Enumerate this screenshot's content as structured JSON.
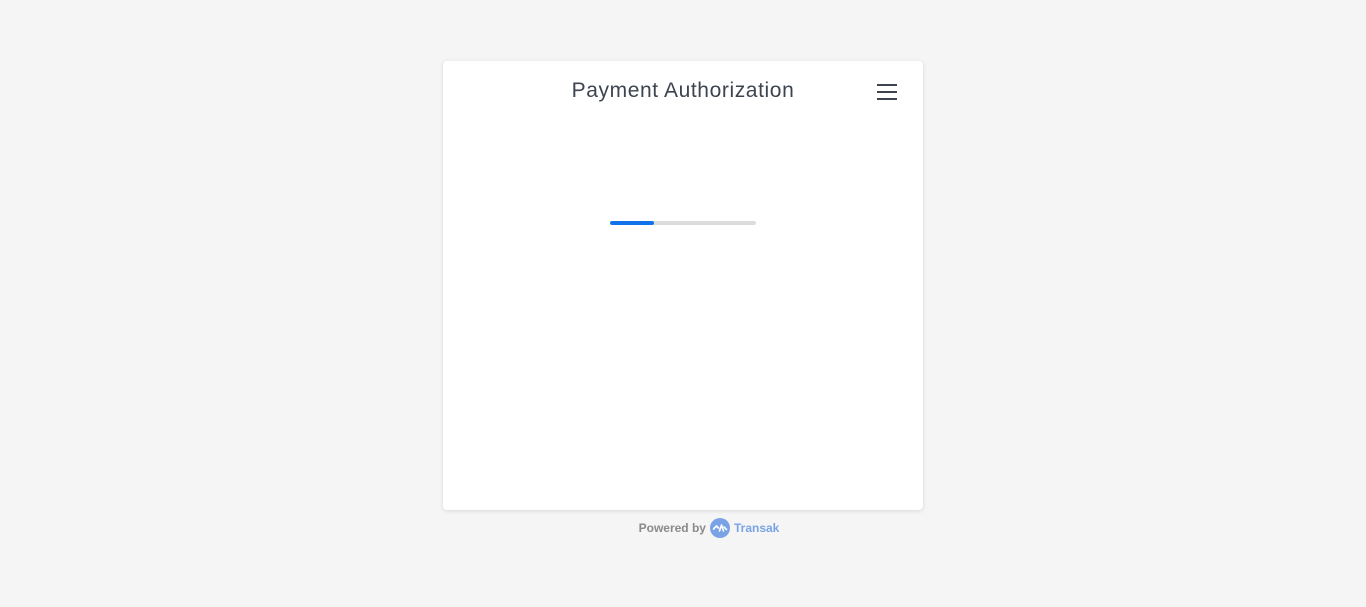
{
  "header": {
    "title": "Payment Authorization",
    "menu_icon": "hamburger-menu-icon"
  },
  "loader": {
    "progress": 0.3,
    "fill_color": "#1173ea",
    "track_color": "#dcdcdc"
  },
  "footer": {
    "powered_label": "Powered by",
    "brand_logo_icon": "transak-logo-icon",
    "brand_name": "Transak",
    "brand_color": "#7aa3e6"
  }
}
